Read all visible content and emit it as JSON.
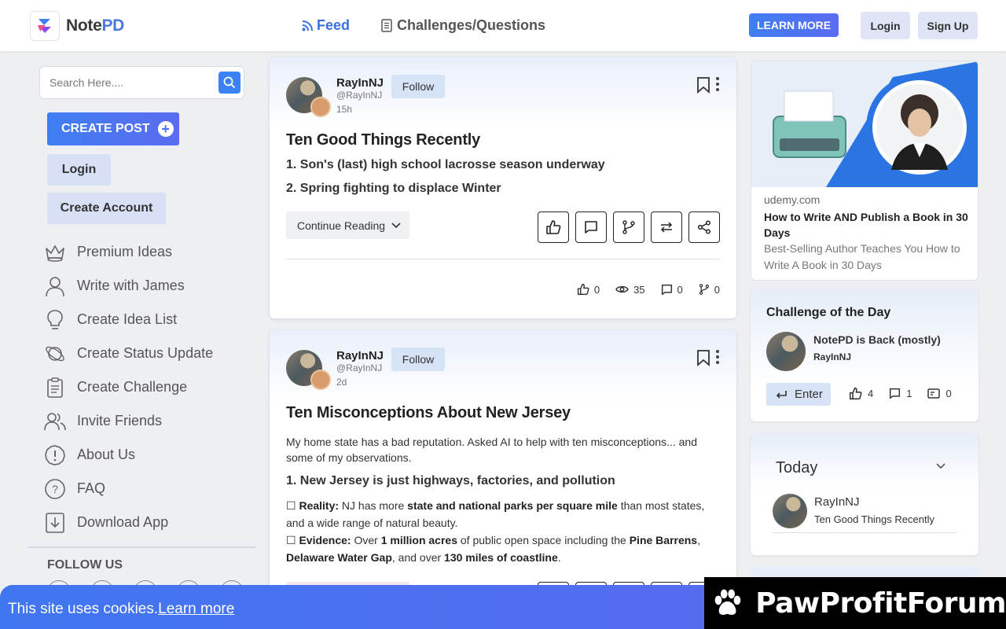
{
  "brand": {
    "name_a": "Note",
    "name_b": "PD"
  },
  "nav": {
    "feed": "Feed",
    "challenges": "Challenges/Questions"
  },
  "header_buttons": {
    "learn_more": "LEARN MORE",
    "login": "Login",
    "signup": "Sign Up"
  },
  "sidebar": {
    "search_placeholder": "Search Here....",
    "create_post": "CREATE POST",
    "login": "Login",
    "create_account": "Create Account",
    "menu": [
      {
        "label": "Premium Ideas",
        "icon": "crown-icon"
      },
      {
        "label": "Write with James",
        "icon": "person-icon"
      },
      {
        "label": "Create Idea List",
        "icon": "lightbulb-icon"
      },
      {
        "label": "Create Status Update",
        "icon": "planet-icon"
      },
      {
        "label": "Create Challenge",
        "icon": "clipboard-icon"
      },
      {
        "label": "Invite Friends",
        "icon": "people-icon"
      },
      {
        "label": "About Us",
        "icon": "exclamation-icon"
      },
      {
        "label": "FAQ",
        "icon": "question-icon"
      },
      {
        "label": "Download App",
        "icon": "download-icon"
      }
    ],
    "follow_us": "FOLLOW US"
  },
  "posts": [
    {
      "author": "RayInNJ",
      "handle": "@RayInNJ",
      "time": "15h",
      "follow": "Follow",
      "title": "Ten Good Things Recently",
      "lines": [
        "1. Son's (last) high school lacrosse season underway",
        "2. Spring fighting to displace Winter"
      ],
      "continue": "Continue Reading",
      "stats": {
        "likes": "0",
        "views": "35",
        "comments": "0",
        "forks": "0"
      }
    },
    {
      "author": "RayInNJ",
      "handle": "@RayInNJ",
      "time": "2d",
      "follow": "Follow",
      "title": "Ten Misconceptions About New Jersey",
      "intro": "My home state has a bad reputation. Asked AI to help with ten misconceptions... and some of my observations.",
      "heading": "1. New Jersey is just highways, factories, and pollution",
      "reality_label": "Reality:",
      "reality_a": " NJ has more ",
      "reality_b": "state and national parks per square mile",
      "reality_c": " than most states, and a wide range of natural beauty.",
      "evidence_label": "Evidence:",
      "evidence_a": " Over ",
      "evidence_b": "1 million acres",
      "evidence_c": " of public open space including the ",
      "evidence_d": "Pine Barrens",
      "evidence_e": ", ",
      "evidence_f": "Delaware Water Gap",
      "evidence_g": ", and over ",
      "evidence_h": "130 miles of coastline",
      "evidence_i": ".",
      "box_glyph": "☐"
    }
  ],
  "ad": {
    "domain": "udemy.com",
    "title": "How to Write AND Publish a Book in 30 Days",
    "description": "Best-Selling Author Teaches You How to Write A Book in 30 Days"
  },
  "challenge": {
    "heading": "Challenge of the Day",
    "title": "NotePD is Back (mostly)",
    "author": "RayInNJ",
    "enter": "Enter",
    "likes": "4",
    "comments": "1",
    "entries": "0"
  },
  "today": {
    "label": "Today",
    "author": "RayInNJ",
    "post": "Ten Good Things Recently"
  },
  "cookie": {
    "text": "This site uses cookies.",
    "link": "Learn more"
  },
  "promo": {
    "text": "PawProfitForum"
  },
  "colors": {
    "accent": "#3b82f6",
    "soft_button": "#d8e0f5",
    "cookie_bar": "#4a72ef"
  }
}
